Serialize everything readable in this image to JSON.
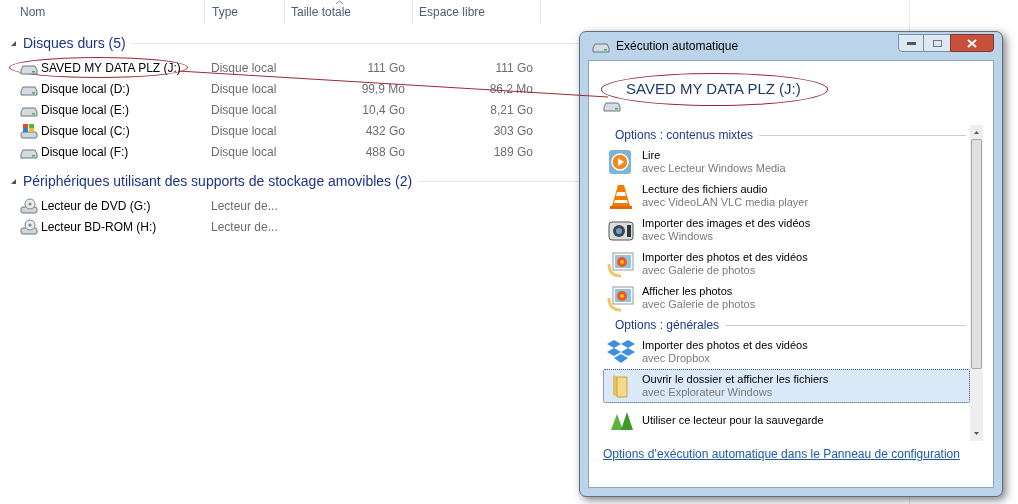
{
  "explorer": {
    "columns": [
      {
        "label": "Nom",
        "sorted": false
      },
      {
        "label": "Type",
        "sorted": false
      },
      {
        "label": "Taille totale",
        "sorted": true
      },
      {
        "label": "Espace libre",
        "sorted": false
      }
    ],
    "groups": [
      {
        "title": "Disques durs (5)",
        "expanded": true,
        "rows": [
          {
            "kind": "hdd",
            "name": "SAVED MY DATA PLZ (J:)",
            "circled": true,
            "type": "Disque local",
            "total": "111 Go",
            "free": "111 Go"
          },
          {
            "kind": "hdd",
            "name": "Disque local (D:)",
            "circled": false,
            "type": "Disque local",
            "total": "99,9 Mo",
            "free": "86,2 Mo"
          },
          {
            "kind": "hdd",
            "name": "Disque local (E:)",
            "circled": false,
            "type": "Disque local",
            "total": "10,4 Go",
            "free": "8,21 Go"
          },
          {
            "kind": "system",
            "name": "Disque local (C:)",
            "circled": false,
            "type": "Disque local",
            "total": "432 Go",
            "free": "303 Go"
          },
          {
            "kind": "hdd",
            "name": "Disque local (F:)",
            "circled": false,
            "type": "Disque local",
            "total": "488 Go",
            "free": "189 Go"
          }
        ]
      },
      {
        "title": "Périphériques utilisant des supports de stockage amovibles (2)",
        "expanded": true,
        "rows": [
          {
            "kind": "optical",
            "name": "Lecteur de DVD (G:)",
            "circled": false,
            "type": "Lecteur de..."
          },
          {
            "kind": "optical",
            "name": "Lecteur BD-ROM (H:)",
            "circled": false,
            "type": "Lecteur de..."
          }
        ]
      }
    ]
  },
  "autoplay": {
    "title": "Exécution automatique",
    "drive": "SAVED MY DATA PLZ (J:)",
    "drive_circled": true,
    "sections": [
      {
        "title": "Options : contenus mixtes",
        "items": [
          {
            "action": "Lire",
            "app": "avec Lecteur Windows Media",
            "selected": false
          },
          {
            "action": "Lecture des fichiers audio",
            "app": "avec VideoLAN VLC media player",
            "selected": false
          },
          {
            "action": "Importer des images et des vidéos",
            "app": "avec Windows",
            "selected": false
          },
          {
            "action": "Importer des photos et des vidéos",
            "app": "avec Galerie de photos",
            "selected": false
          },
          {
            "action": "Afficher les photos",
            "app": "avec Galerie de photos",
            "selected": false
          }
        ]
      },
      {
        "title": "Options : générales",
        "items": [
          {
            "action": "Importer des photos et des vidéos",
            "app": "avec Dropbox",
            "selected": false
          },
          {
            "action": "Ouvrir le dossier et afficher les fichiers",
            "app": "avec Explorateur Windows",
            "selected": true
          },
          {
            "action": "Utiliser ce lecteur pour la sauvegarde",
            "selected": false
          }
        ]
      }
    ],
    "link": "Options d’exécution automatique dans le Panneau de configuration"
  }
}
